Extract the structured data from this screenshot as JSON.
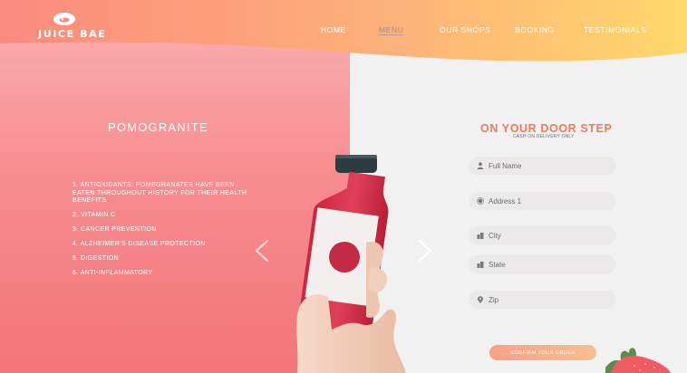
{
  "brand": {
    "name": "JUICE BAE"
  },
  "nav": {
    "items": [
      {
        "label": "HOME",
        "active": false
      },
      {
        "label": "MENU",
        "active": true
      },
      {
        "label": "OUR SHOPS",
        "active": false
      },
      {
        "label": "BOOKING",
        "active": false
      },
      {
        "label": "TESTIMONIALS",
        "active": false
      }
    ]
  },
  "product": {
    "title": "POMOGRANITE",
    "benefits": [
      "1. ANTIOXIDANTS: POMEGRANATES HAVE BEEN EATEN THROUGHOUT HISTORY FOR THEIR HEALTH BENEFITS",
      "2. VITAMIN C",
      "3. CANCER PREVENTION",
      "4. ALZHEIMER'S DISEASE PROTECTION",
      "5. DIGESTION",
      "6. ANTI-INFLAMMATORY"
    ]
  },
  "order_form": {
    "title": "ON YOUR DOOR STEP",
    "subtitle": "CASH ON DELIVERY ONLY",
    "fields": [
      {
        "placeholder": "Full Name",
        "icon": "person-icon"
      },
      {
        "placeholder": "Address 1",
        "icon": "location-icon"
      },
      {
        "placeholder": "City",
        "icon": "city-icon"
      },
      {
        "placeholder": "State",
        "icon": "state-icon"
      },
      {
        "placeholder": "Zip",
        "icon": "pin-icon"
      }
    ],
    "confirm_label": "CONFIRM YOUR ORDER"
  },
  "colors": {
    "accent": "#f07b58",
    "left_panel": "#f78e92",
    "header_start": "#fb8a7d",
    "header_end": "#ffd86b",
    "juice": "#d8314a",
    "background": "#f2f1f1"
  }
}
